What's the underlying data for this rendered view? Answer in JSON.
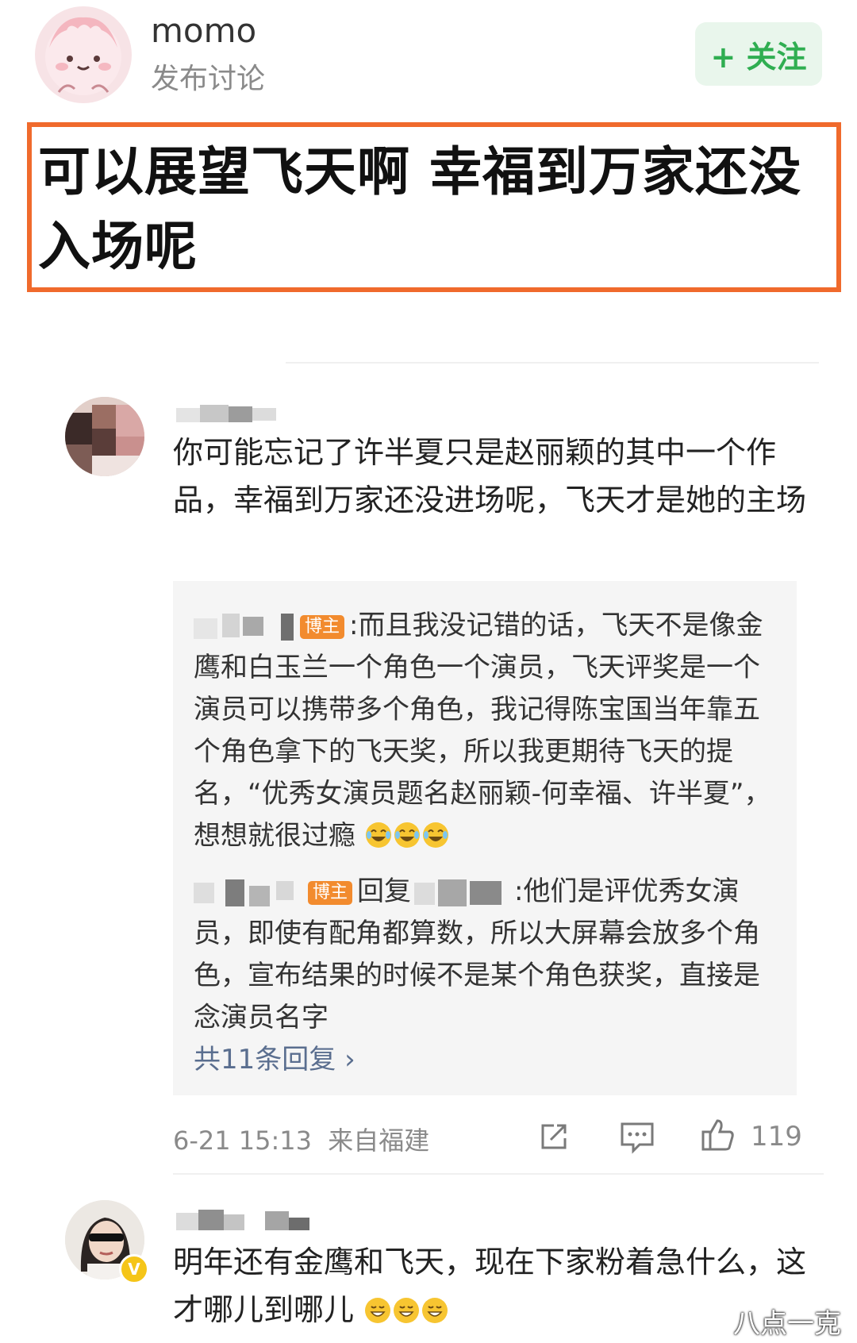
{
  "header": {
    "author_name": "momo",
    "author_subtitle": "发布讨论",
    "follow_label": "+ 关注"
  },
  "post": {
    "headline": "可以展望飞天啊 幸福到万家还没入场呢",
    "headline_border_color": "#f06a2c"
  },
  "comments": [
    {
      "text": "你可能忘记了许半夏只是赵丽颖的其中一个作品，幸福到万家还没进场呢，飞天才是她的主场",
      "replies": [
        {
          "tag": "博主",
          "text": ":而且我没记错的话，飞天不是像金鹰和白玉兰一个角色一个演员，飞天评奖是一个演员可以携带多个角色，我记得陈宝国当年靠五个角色拿下的飞天奖，所以我更期待飞天的提名，“优秀女演员题名赵丽颖-何幸福、许半夏”，想想就很过瘾",
          "emoji": "laughing-tears-emoji x3"
        },
        {
          "tag": "博主",
          "reply_word": "回复",
          "text": ":他们是评优秀女演员，即使有配角都算数，所以大屏幕会放多个角色，宣布结果的时候不是某个角色获奖，直接是念演员名字"
        }
      ],
      "more_replies": "共11条回复 ›",
      "time": "6-21 15:13",
      "location": "来自福建",
      "likes": "119"
    },
    {
      "text": "明年还有金鹰和飞天，现在下家粉着急什么，这才哪儿到哪儿",
      "emoji": "grin-emoji x3",
      "verified": true
    }
  ],
  "watermark": "八点一克",
  "colors": {
    "follow_green": "#2fae51",
    "blogger_tag": "#f28b2e",
    "link_blue": "#5a6e8f"
  }
}
